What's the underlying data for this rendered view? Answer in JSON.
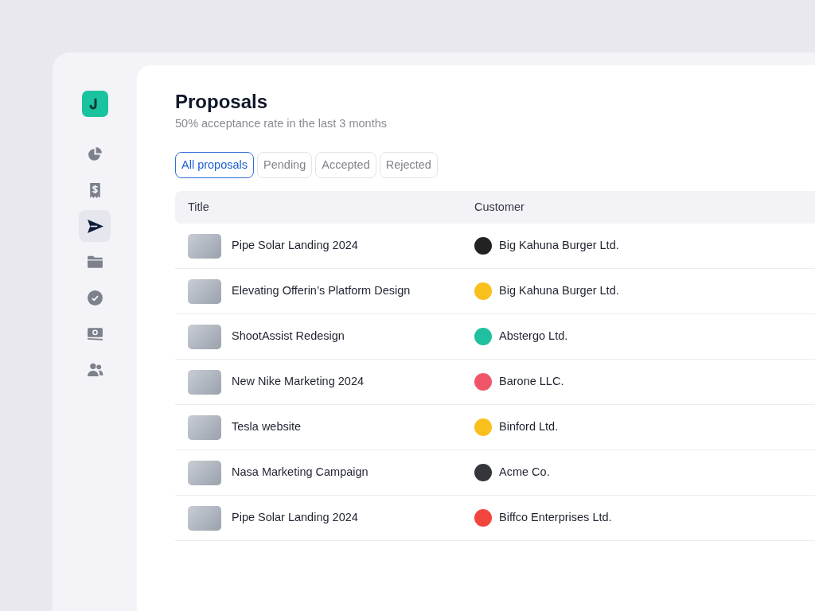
{
  "sidebar": {
    "items": [
      {
        "kind": "chart",
        "selected": false
      },
      {
        "kind": "receipt",
        "selected": false
      },
      {
        "kind": "send",
        "selected": true
      },
      {
        "kind": "folder",
        "selected": false
      },
      {
        "kind": "check",
        "selected": false
      },
      {
        "kind": "money",
        "selected": false
      },
      {
        "kind": "users",
        "selected": false
      }
    ]
  },
  "header": {
    "title": "Proposals",
    "subtitle": "50% acceptance rate in the last 3 months"
  },
  "tabs": [
    {
      "label": "All proposals",
      "selected": true
    },
    {
      "label": "Pending",
      "selected": false
    },
    {
      "label": "Accepted",
      "selected": false
    },
    {
      "label": "Rejected",
      "selected": false
    }
  ],
  "table": {
    "columns": [
      "Title",
      "Customer"
    ],
    "rows": [
      {
        "title": "Pipe Solar Landing 2024",
        "customer": "Big Kahuna Burger Ltd.",
        "color": "#222222"
      },
      {
        "title": "Elevating Offerin’s Platform Design",
        "customer": "Big Kahuna Burger Ltd.",
        "color": "#f8c01c"
      },
      {
        "title": "ShootAssist Redesign",
        "customer": "Abstergo Ltd.",
        "color": "#1fbf9f"
      },
      {
        "title": "New Nike Marketing 2024",
        "customer": "Barone LLC.",
        "color": "#f0566a"
      },
      {
        "title": "Tesla website",
        "customer": "Binford Ltd.",
        "color": "#f8c01c"
      },
      {
        "title": "Nasa Marketing Campaign",
        "customer": "Acme Co.",
        "color": "#34363c"
      },
      {
        "title": "Pipe Solar Landing 2024",
        "customer": "Biffco Enterprises Ltd.",
        "color": "#f2453d"
      }
    ]
  }
}
